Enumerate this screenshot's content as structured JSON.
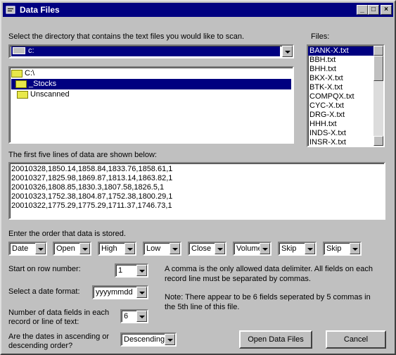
{
  "window": {
    "title": "Data Files"
  },
  "directory": {
    "prompt": "Select the directory that contains the text files you would like to scan.",
    "drive": "c:",
    "tree": [
      {
        "label": "C:\\",
        "selected": false
      },
      {
        "label": "_Stocks",
        "selected": true
      },
      {
        "label": "Unscanned",
        "selected": false
      }
    ]
  },
  "files": {
    "label": "Files:",
    "items": [
      "BANK-X.txt",
      "BBH.txt",
      "BHH.txt",
      "BKX-X.txt",
      "BTK-X.txt",
      "COMPQX.txt",
      "CYC-X.txt",
      "DRG-X.txt",
      "HHH.txt",
      "INDS-X.txt",
      "INSR-X.txt"
    ],
    "selected_index": 0
  },
  "preview": {
    "label": "The first five lines of data are shown below:",
    "lines": [
      "20010328,1850.14,1858.84,1833.76,1858.61,1",
      "20010327,1825.98,1869.87,1813.14,1863.82,1",
      "20010326,1808.85,1830.3,1807.58,1826.5,1",
      "20010323,1752.38,1804.87,1752.38,1800.29,1",
      "20010322,1775.29,1775.29,1711.37,1746.73,1"
    ]
  },
  "order": {
    "label": "Enter the order that data is stored.",
    "fields": [
      "Date",
      "Open",
      "High",
      "Low",
      "Close",
      "Volume",
      "Skip",
      "Skip"
    ]
  },
  "options": {
    "start_row_label": "Start on row number:",
    "start_row_value": "1",
    "date_format_label": "Select a date format:",
    "date_format_value": "yyyymmdd",
    "num_fields_label_1": "Number of data fields in each",
    "num_fields_label_2": "record or line of text:",
    "num_fields_value": "6",
    "order_label_1": "Are the dates in ascending or",
    "order_label_2": "descending order?",
    "order_value": "Descending"
  },
  "info": {
    "delimiter_1": "A comma is the only allowed data delimiter. All fields on each",
    "delimiter_2": "record line must be separated by commas.",
    "note_1": "Note: There appear to be  6 fields seperated by  5 commas in",
    "note_2": "the 5th line of this file."
  },
  "buttons": {
    "open": "Open Data Files",
    "cancel": "Cancel"
  }
}
